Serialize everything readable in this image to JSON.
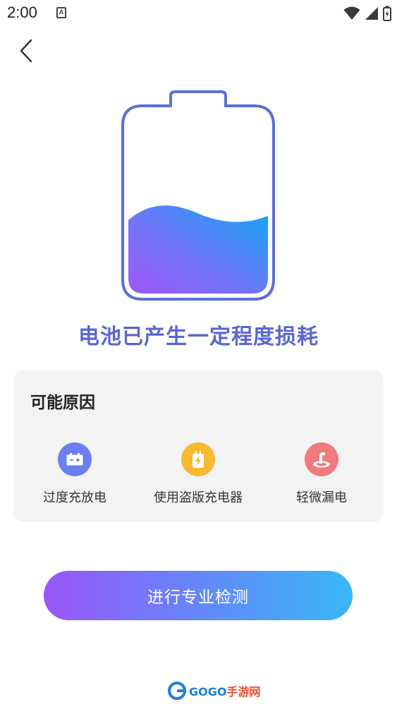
{
  "status_bar": {
    "time": "2:00",
    "notification_letter": "A"
  },
  "navigation": {
    "back_icon": "chevron-left-icon"
  },
  "battery": {
    "fill_level": 0.4,
    "outline_color": "#5b6fd6",
    "fill_gradient": [
      "#a157f8",
      "#6e76f7",
      "#0fa6f2"
    ]
  },
  "main": {
    "title": "电池已产生一定程度损耗"
  },
  "reasons": {
    "heading": "可能原因",
    "items": [
      {
        "label": "过度充放电",
        "icon": "battery-icon",
        "color": "#6b7ff0"
      },
      {
        "label": "使用盗版充电器",
        "icon": "charger-icon",
        "color": "#f7b92f"
      },
      {
        "label": "轻微漏电",
        "icon": "leak-icon",
        "color": "#f07a7e"
      }
    ]
  },
  "action": {
    "detect_label": "进行专业检测"
  },
  "watermark": {
    "brand": "GOGO",
    "suffix": "手游网",
    "url": "www.gogo.cn"
  }
}
